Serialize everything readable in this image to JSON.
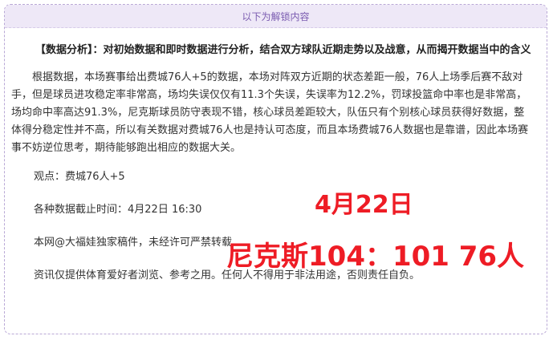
{
  "banner": {
    "label": "以下为解锁内容"
  },
  "article": {
    "heading": "【数据分析】：对初始数据和即时数据进行分析，结合双方球队近期走势以及战意，从而揭开数据当中的含义",
    "body": "根据数据，本场赛事给出费城76人+5的数据，本场对阵双方近期的状态差距一般，76人上场季后赛不敌对手，但是球员进攻稳定率非常高，场均失误仅仅有11.3个失误，失误率为12.2%，罚球投篮命中率也是非常高，场均命中率高达91.3%，尼克斯球员防守表现不错，核心球员差距较大，队伍只有个别核心球员获得好数据，整体得分稳定性并不高，所以有关数据对费城76人也是持认可态度，而且本场费城76人数据也是靠谱，因此本场赛事不妨逆位思考，期待能够跑出相应的数据大关。",
    "viewpoint": "观点：费城76人+5",
    "deadline": "各种数据截止时间：4月22日 16:30",
    "copyright": "本网@大福娃独家稿件，未经许可严禁转载",
    "disclaimer": "资讯仅提供体育爱好者浏览、参考之用。任何人不得用于非法用途，否则责任自负。"
  },
  "overlay": {
    "date": "4月22日",
    "score": "尼克斯104：101 76人"
  },
  "colors": {
    "banner_bg": "#eee8f7",
    "banner_text": "#7a5bb0",
    "border": "#b9a8d6",
    "overlay_red": "#ee1c25"
  }
}
